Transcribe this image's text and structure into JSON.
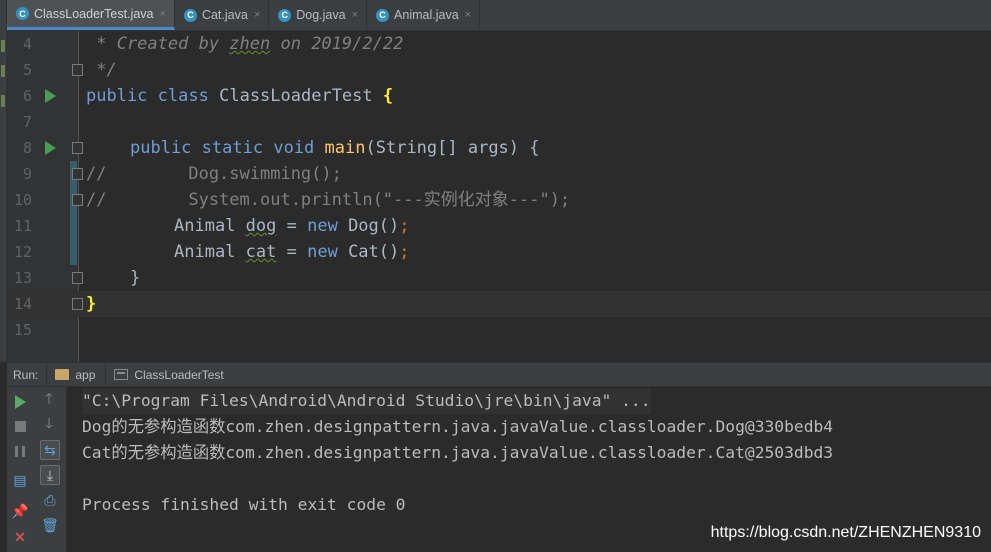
{
  "tabs": [
    {
      "icon": "C",
      "label": "ClassLoaderTest.java",
      "active": true
    },
    {
      "icon": "C",
      "label": "Cat.java",
      "active": false
    },
    {
      "icon": "C",
      "label": "Dog.java",
      "active": false
    },
    {
      "icon": "C",
      "label": "Animal.java",
      "active": false
    }
  ],
  "tab_close_glyph": "×",
  "editor": {
    "line_numbers": [
      "4",
      "5",
      "6",
      "7",
      "8",
      "9",
      "10",
      "11",
      "12",
      "13",
      "14",
      "15"
    ],
    "line4": {
      "prefix": " * Created by ",
      "author": "zhen",
      "suffix": " on 2019/2/22"
    },
    "line5": {
      "text": " */"
    },
    "line6": {
      "kw1": "public",
      "kw2": "class",
      "name": "ClassLoaderTest",
      "brace": "{"
    },
    "line8": {
      "kw1": "public",
      "kw2": "static",
      "kw3": "void",
      "method": "main",
      "params": "(String[] args) {"
    },
    "line9": {
      "text": "//        Dog.swimming();"
    },
    "line10": {
      "text": "//        System.out.println(\"---实例化对象---\");"
    },
    "line11": {
      "type": "Animal",
      "var": "dog",
      "eq": " = ",
      "kw": "new",
      "ctor": " Dog()",
      "semi": ";"
    },
    "line12": {
      "type": "Animal",
      "var": "cat",
      "eq": " = ",
      "kw": "new",
      "ctor": " Cat()",
      "semi": ";"
    },
    "line13": {
      "text": "}"
    },
    "line14": {
      "text": "}"
    }
  },
  "run_panel": {
    "label": "Run:",
    "tabs": [
      {
        "label": "app"
      },
      {
        "label": "ClassLoaderTest"
      }
    ]
  },
  "console": {
    "lines": [
      "\"C:\\Program Files\\Android\\Android Studio\\jre\\bin\\java\" ...",
      "Dog的无参构造函数com.zhen.designpattern.java.javaValue.classloader.Dog@330bedb4",
      "Cat的无参构造函数com.zhen.designpattern.java.javaValue.classloader.Cat@2503dbd3",
      "",
      "Process finished with exit code 0"
    ]
  },
  "watermark": "https://blog.csdn.net/ZHENZHEN9310",
  "colors": {
    "background": "#2b2b2b",
    "keyword": "#cc7832",
    "method": "#ffc66d",
    "comment": "#808080",
    "run_green": "#59a869",
    "tab_accent": "#4a88c7"
  }
}
